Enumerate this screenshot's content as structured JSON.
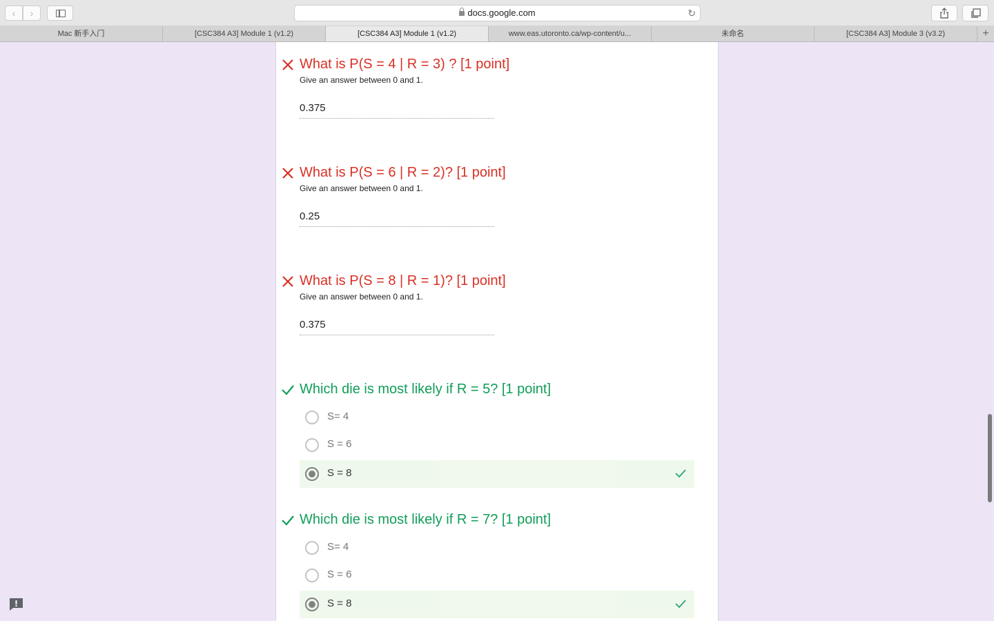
{
  "browser": {
    "url": "docs.google.com",
    "tabs": [
      {
        "label": "Mac 新手入门",
        "active": false
      },
      {
        "label": "[CSC384 A3] Module 1 (v1.2)",
        "active": false
      },
      {
        "label": "[CSC384 A3] Module 1 (v1.2)",
        "active": true
      },
      {
        "label": "www.eas.utoronto.ca/wp-content/u...",
        "active": false
      },
      {
        "label": "未命名",
        "active": false
      },
      {
        "label": "[CSC384 A3] Module 3 (v3.2)",
        "active": false
      }
    ],
    "new_tab_label": "+"
  },
  "questions": [
    {
      "status": "incorrect",
      "title": "What is P(S = 4 | R = 3) ? [1 point]",
      "help": "Give an answer between 0 and 1.",
      "answer": "0.375"
    },
    {
      "status": "incorrect",
      "title": "What is P(S = 6 | R = 2)? [1 point]",
      "help": "Give an answer between 0 and 1.",
      "answer": "0.25"
    },
    {
      "status": "incorrect",
      "title": "What is P(S = 8 | R = 1)? [1 point]",
      "help": "Give an answer between 0 and 1.",
      "answer": "0.375"
    },
    {
      "status": "correct",
      "title": "Which die is most likely if R = 5? [1 point]",
      "options": [
        "S= 4",
        "S = 6",
        "S = 8"
      ],
      "selected_index": 2
    },
    {
      "status": "correct",
      "title": "Which die is most likely if R = 7? [1 point]",
      "options": [
        "S= 4",
        "S = 6",
        "S = 8"
      ],
      "selected_index": 2
    }
  ],
  "colors": {
    "incorrect": "#d93025",
    "correct": "#0f9d58",
    "page_background": "#ede4f5",
    "selected_option_background": "#eef8ea"
  },
  "icons": {
    "incorrect": "close-icon",
    "correct": "check-icon",
    "feedback": "feedback-icon"
  }
}
